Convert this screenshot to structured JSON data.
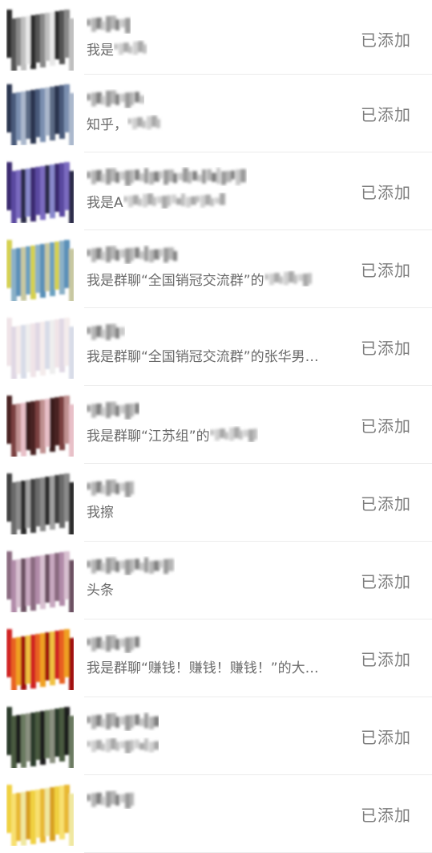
{
  "contacts": [
    {
      "message": "我是",
      "status": "已添加",
      "colors": [
        "#2a2a2a",
        "#555555",
        "#888888",
        "#bfbfbf",
        "#e8e8e8"
      ]
    },
    {
      "message": "知乎，",
      "status": "已添加",
      "colors": [
        "#2c3550",
        "#4a5a7a",
        "#7a8fb0",
        "#aab8cc",
        "#5b6a85"
      ]
    },
    {
      "message": "我是A",
      "status": "已添加",
      "colors": [
        "#3a2a70",
        "#5a4aa0",
        "#7a6ac0",
        "#2a2a4a",
        "#8888cc"
      ]
    },
    {
      "message": "我是群聊“全国销冠交流群”的",
      "status": "已添加",
      "colors": [
        "#d4d050",
        "#8ab0c8",
        "#5a90b8",
        "#c8c8a0",
        "#6aa0c0"
      ]
    },
    {
      "message": "我是群聊“全国销冠交流群”的张华男…",
      "status": "已添加",
      "colors": [
        "#f0e4e8",
        "#e0d8e4",
        "#f4ecec",
        "#d8dce8",
        "#eeeeee"
      ]
    },
    {
      "message": "我是群聊“江苏组”的",
      "status": "已添加",
      "colors": [
        "#4a2020",
        "#7a4040",
        "#c09090",
        "#e8c0c8",
        "#3a1a1a"
      ]
    },
    {
      "message": "我擦",
      "status": "已添加",
      "colors": [
        "#404040",
        "#6a6a6a",
        "#8a8a8a",
        "#2a2a2a",
        "#a0a0a0"
      ]
    },
    {
      "message": "头条",
      "status": "已添加",
      "colors": [
        "#8a6a80",
        "#b08aa8",
        "#d8c0d0",
        "#6a5060",
        "#c8a8c0"
      ]
    },
    {
      "message": "我是群聊“赚钱！赚钱！赚钱！”的大…",
      "status": "已添加",
      "colors": [
        "#d02020",
        "#e86020",
        "#f0a020",
        "#a01010",
        "#f0c040"
      ]
    },
    {
      "message": "",
      "status": "已添加",
      "colors": [
        "#2a3a2a",
        "#4a5a40",
        "#1a1a1a",
        "#6a7a60",
        "#8a9080"
      ]
    },
    {
      "message": "",
      "status": "已添加",
      "colors": [
        "#f0d040",
        "#f8e070",
        "#e8b830",
        "#f0e8a0",
        "#d8a020"
      ]
    }
  ]
}
